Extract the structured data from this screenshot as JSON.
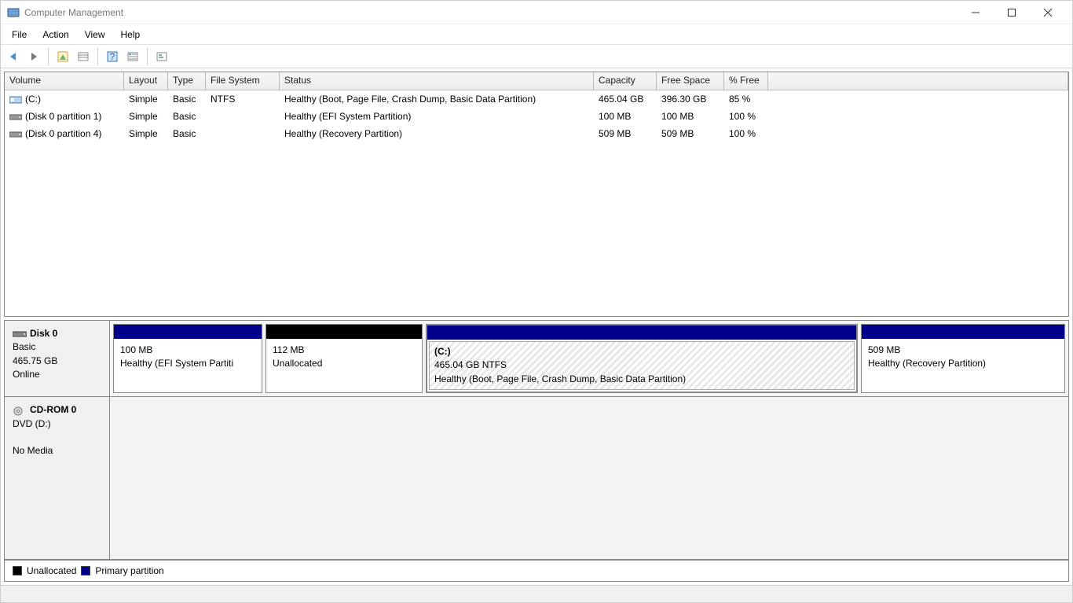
{
  "window": {
    "title": "Computer Management"
  },
  "menu": {
    "file": "File",
    "action": "Action",
    "view": "View",
    "help": "Help"
  },
  "columns": {
    "volume": "Volume",
    "layout": "Layout",
    "type": "Type",
    "fs": "File System",
    "status": "Status",
    "capacity": "Capacity",
    "free": "Free Space",
    "pct": "% Free"
  },
  "volumes": [
    {
      "name": "(C:)",
      "layout": "Simple",
      "type": "Basic",
      "fs": "NTFS",
      "status": "Healthy (Boot, Page File, Crash Dump, Basic Data Partition)",
      "capacity": "465.04 GB",
      "free": "396.30 GB",
      "pct": "85 %",
      "icon": "drive"
    },
    {
      "name": "(Disk 0 partition 1)",
      "layout": "Simple",
      "type": "Basic",
      "fs": "",
      "status": "Healthy (EFI System Partition)",
      "capacity": "100 MB",
      "free": "100 MB",
      "pct": "100 %",
      "icon": "part"
    },
    {
      "name": "(Disk 0 partition 4)",
      "layout": "Simple",
      "type": "Basic",
      "fs": "",
      "status": "Healthy (Recovery Partition)",
      "capacity": "509 MB",
      "free": "509 MB",
      "pct": "100 %",
      "icon": "part"
    }
  ],
  "disk0": {
    "header": {
      "name": "Disk 0",
      "type": "Basic",
      "size": "465.75 GB",
      "status": "Online"
    },
    "parts": [
      {
        "title": "",
        "line2": "100 MB",
        "line3": "Healthy (EFI System Partiti",
        "bar": "primary",
        "flex": 190,
        "selected": false
      },
      {
        "title": "",
        "line2": "112 MB",
        "line3": "Unallocated",
        "bar": "unalloc",
        "flex": 200,
        "selected": false
      },
      {
        "title": "(C:)",
        "line2": "465.04 GB NTFS",
        "line3": "Healthy (Boot, Page File, Crash Dump, Basic Data Partition)",
        "bar": "primary",
        "flex": 550,
        "selected": true
      },
      {
        "title": "",
        "line2": "509 MB",
        "line3": "Healthy (Recovery Partition)",
        "bar": "primary",
        "flex": 260,
        "selected": false
      }
    ]
  },
  "cdrom": {
    "name": "CD-ROM 0",
    "line2": "DVD (D:)",
    "line3": "No Media"
  },
  "legend": {
    "unalloc": "Unallocated",
    "primary": "Primary partition"
  }
}
